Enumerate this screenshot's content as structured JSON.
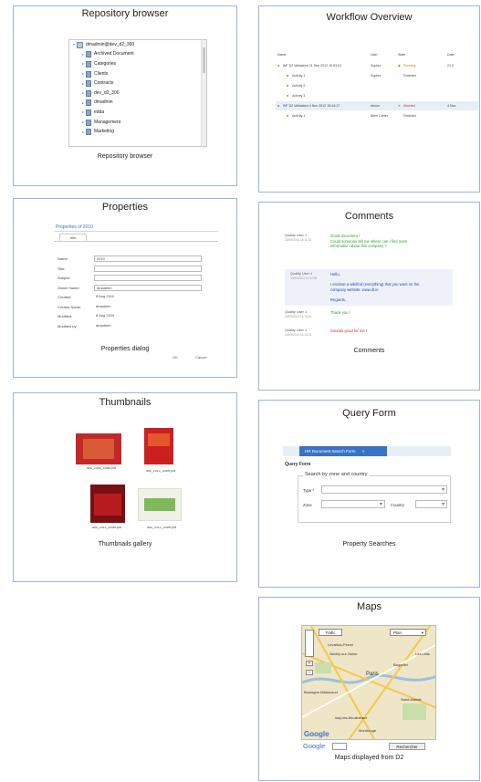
{
  "repository": {
    "title": "Repository browser",
    "root": "dmadmin@dev_d2_300",
    "items": [
      "Archived Document",
      "Categories",
      "Clients",
      "Contracts",
      "dev_d2_300",
      "dmadmin",
      "edda",
      "Management",
      "Marketing"
    ],
    "caption": "Repository browser"
  },
  "workflow": {
    "title": "Workflow Overview",
    "headers": [
      "Name",
      "User",
      "State",
      "Date"
    ],
    "rows": [
      {
        "name": "WF D2 Validation 21 Sep 2012 10:53:51",
        "user": "Sophie",
        "state": "Running",
        "date": "21.9"
      },
      {
        "name": "Activity 1",
        "user": "Sophie",
        "state": "Finished",
        "date": ""
      },
      {
        "name": "Activity 2",
        "user": "",
        "state": "",
        "date": ""
      },
      {
        "name": "Activity 3",
        "user": "",
        "state": "",
        "date": ""
      },
      {
        "name": "WF D2 Validation 4 Nov 2012 15:44:17",
        "user": "dmum",
        "state": "Aborted",
        "date": "4.Nov"
      },
      {
        "name": "Activity 1",
        "user": "Allen Carter",
        "state": "Finished",
        "date": ""
      }
    ]
  },
  "properties": {
    "title": "Properties",
    "dialog_title": "Properties of 2010",
    "tab": "Info",
    "fields": [
      {
        "label": "Name:",
        "value": "2010"
      },
      {
        "label": "Title:",
        "value": ""
      },
      {
        "label": "Subject:",
        "value": ""
      },
      {
        "label": "Owner Name:",
        "value": "dmadmin"
      },
      {
        "label": "Created:",
        "value": "8 Aug 2010"
      },
      {
        "label": "Creator Name:",
        "value": "dmadmin"
      },
      {
        "label": "Modified:",
        "value": "8 Aug 2010"
      },
      {
        "label": "Modified by:",
        "value": "dmadmin"
      }
    ],
    "ok": "OK",
    "cancel": "Cancel",
    "caption": "Properties dialog"
  },
  "comments": {
    "title": "Comments",
    "entries": [
      {
        "user": "Quality User 1",
        "date": "20/09/2013 14:11:33",
        "text": [
          "Good document !",
          "Could someone tell me where can I find more",
          "information about this company ?"
        ],
        "color": "#2e9b2e"
      },
      {
        "user": "Quality User 1",
        "date": "20/09/2013 14:12:05",
        "text": [
          "Hello,",
          "",
          "I enclose a wikifind (everything) that you want on the",
          "company website: www.dt.ie",
          "",
          "Regards,"
        ],
        "color": "#2545b8"
      },
      {
        "user": "Quality User 1",
        "date": "20/09/2013 14:12:40",
        "text": [
          "Thank you !"
        ],
        "color": "#2e9b2e"
      },
      {
        "user": "Quality User 1",
        "date": "20/09/2013 14:13:01",
        "text": [
          "Sounds good for me !"
        ],
        "color": "#c23030"
      }
    ],
    "caption": "Comments"
  },
  "thumbnails": {
    "title": "Thumbnails",
    "items": [
      "doc_2009_cover.pdf",
      "doc_2010_cover.pdf",
      "doc_2011_cover.pdf",
      "doc_2012_cover.pdf"
    ],
    "caption": "Thumbnails gallery"
  },
  "query": {
    "title": "Query Form",
    "tab": "HR Document Search Form",
    "form_title": "Query Form",
    "group": "Search by zone and country",
    "type_label": "Type *",
    "zone_label": "Zone",
    "country_label": "Country",
    "caption": "Property Searches"
  },
  "maps": {
    "title": "Maps",
    "btn_traffic": "Trafic",
    "btn_plan": "Plan",
    "places": [
      "Levallois-Perret",
      "Neuilly-sur-Seine",
      "Paris",
      "Boulogne-Billancourt",
      "Issy-les-Moulineaux",
      "Montrouge",
      "Bagnolet",
      "Saint-Mandé",
      "Les Lilas"
    ],
    "google": "Google",
    "search_btn": "Rechercher",
    "caption": "Maps displayed from D2"
  },
  "colors": {
    "border": "#9bb5db",
    "accent": "#3b73c4"
  }
}
